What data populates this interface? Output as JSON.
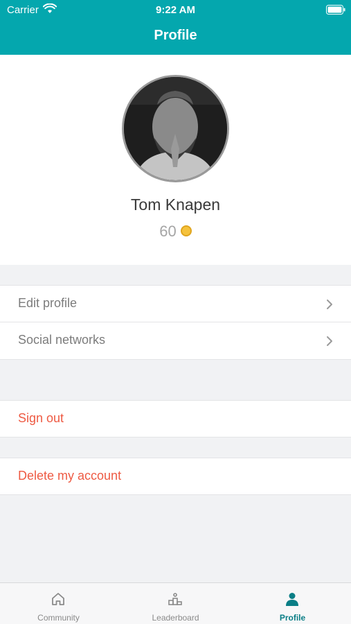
{
  "status_bar": {
    "carrier": "Carrier",
    "time": "9:22 AM"
  },
  "header": {
    "title": "Profile"
  },
  "profile": {
    "name": "Tom Knapen",
    "points": "60",
    "coin_icon": "coin-icon"
  },
  "menu": {
    "edit_profile": "Edit profile",
    "social_networks": "Social networks",
    "sign_out": "Sign out",
    "delete_account": "Delete my account"
  },
  "tabs": [
    {
      "label": "Community",
      "icon": "home-icon"
    },
    {
      "label": "Leaderboard",
      "icon": "podium-icon"
    },
    {
      "label": "Profile",
      "icon": "person-icon"
    }
  ],
  "colors": {
    "brand": "#04a7ae",
    "danger": "#ee5a43",
    "active_tab": "#0a7e86"
  }
}
